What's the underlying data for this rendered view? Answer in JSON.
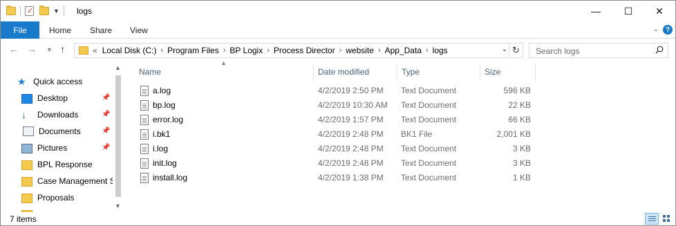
{
  "window": {
    "title": "logs",
    "minimize_glyph": "—",
    "maximize_glyph": "☐",
    "close_glyph": "✕"
  },
  "ribbon": {
    "file_tab": "File",
    "tabs": [
      "Home",
      "Share",
      "View"
    ]
  },
  "address": {
    "overflow": "«",
    "crumbs": [
      "Local Disk (C:)",
      "Program Files",
      "BP Logix",
      "Process Director",
      "website",
      "App_Data",
      "logs"
    ]
  },
  "search": {
    "placeholder": "Search logs"
  },
  "nav_pane": {
    "items": [
      {
        "label": "Quick access",
        "icon": "star-icon",
        "pinned": false
      },
      {
        "label": "Desktop",
        "icon": "desktop-icon",
        "pinned": true
      },
      {
        "label": "Downloads",
        "icon": "download-icon",
        "pinned": true
      },
      {
        "label": "Documents",
        "icon": "documents-icon",
        "pinned": true
      },
      {
        "label": "Pictures",
        "icon": "pictures-icon",
        "pinned": true
      },
      {
        "label": "BPL Response",
        "icon": "folder-icon",
        "pinned": false
      },
      {
        "label": "Case Management S",
        "icon": "folder-icon",
        "pinned": false
      },
      {
        "label": "Proposals",
        "icon": "folder-icon",
        "pinned": false
      }
    ]
  },
  "columns": {
    "name": "Name",
    "date": "Date modified",
    "type": "Type",
    "size": "Size"
  },
  "files": [
    {
      "name": "a.log",
      "date": "4/2/2019 2:50 PM",
      "type": "Text Document",
      "size": "596 KB"
    },
    {
      "name": "bp.log",
      "date": "4/2/2019 10:30 AM",
      "type": "Text Document",
      "size": "22 KB"
    },
    {
      "name": "error.log",
      "date": "4/2/2019 1:57 PM",
      "type": "Text Document",
      "size": "66 KB"
    },
    {
      "name": "i.bk1",
      "date": "4/2/2019 2:48 PM",
      "type": "BK1 File",
      "size": "2,001 KB"
    },
    {
      "name": "i.log",
      "date": "4/2/2019 2:48 PM",
      "type": "Text Document",
      "size": "3 KB"
    },
    {
      "name": "init.log",
      "date": "4/2/2019 2:48 PM",
      "type": "Text Document",
      "size": "3 KB"
    },
    {
      "name": "install.log",
      "date": "4/2/2019 1:38 PM",
      "type": "Text Document",
      "size": "1 KB"
    }
  ],
  "status": {
    "item_count": "7 items"
  },
  "colors": {
    "accent": "#1979ca",
    "folder": "#f3c94e",
    "header_text": "#4c607a"
  }
}
